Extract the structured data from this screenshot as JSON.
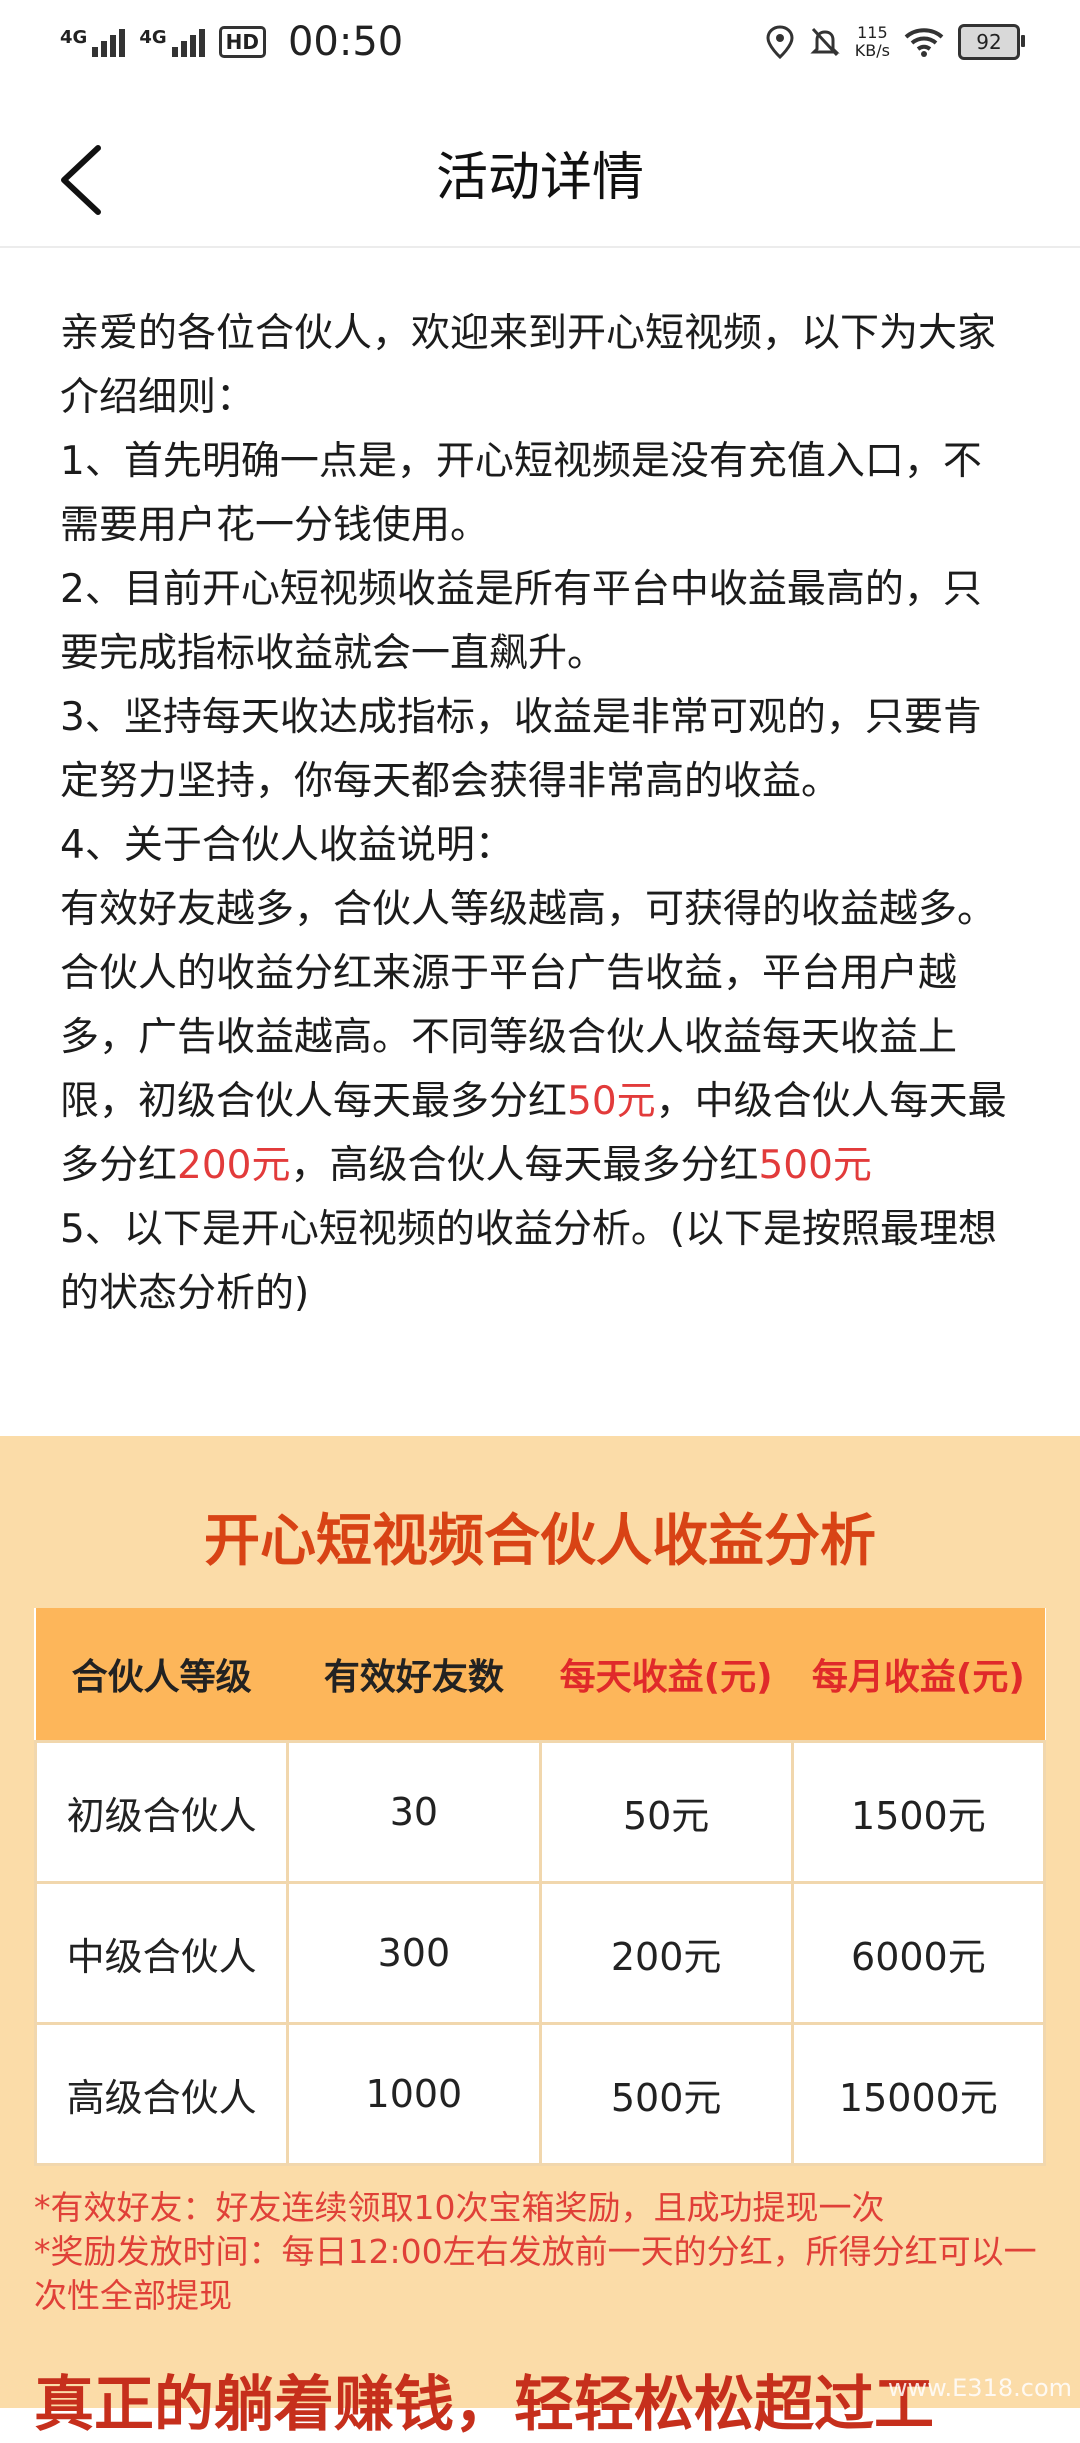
{
  "status_bar": {
    "signal1_label": "4G",
    "signal2_label": "4G",
    "hd_label": "HD",
    "time": "00:50",
    "speed_value": "115",
    "speed_unit": "KB/s",
    "battery": "92"
  },
  "header": {
    "title": "活动详情"
  },
  "intro": {
    "lines": [
      "亲爱的各位合伙人，欢迎来到开心短视频，以下为大家介绍细则：",
      "1、首先明确一点是，开心短视频是没有充值入口，不需要用户花一分钱使用。",
      "2、目前开心短视频收益是所有平台中收益最高的，只要完成指标收益就会一直飙升。",
      "3、坚持每天收达成指标，收益是非常可观的，只要肯定努力坚持，你每天都会获得非常高的收益。",
      "4、关于合伙人收益说明："
    ],
    "p6_a": "有效好友越多，合伙人等级越高，可获得的收益越多。合伙人的收益分红来源于平台广告收益，平台用户越多，广告收益越高。不同等级合伙人收益每天收益上限，初级合伙人每天最多分红",
    "p6_r1": "50元",
    "p6_b": "，中级合伙人每天最多分红",
    "p6_r2": "200元",
    "p6_c": "，高级合伙人每天最多分红",
    "p6_r3": "500元",
    "p7": "5、以下是开心短视频的收益分析。(以下是按照最理想的状态分析的)"
  },
  "promo": {
    "title": "开心短视频合伙人收益分析",
    "table": {
      "headers": [
        "合伙人等级",
        "有效好友数",
        "每天收益(元)",
        "每月收益(元)"
      ],
      "rows": [
        [
          "初级合伙人",
          "30",
          "50元",
          "1500元"
        ],
        [
          "中级合伙人",
          "300",
          "200元",
          "6000元"
        ],
        [
          "高级合伙人",
          "1000",
          "500元",
          "15000元"
        ]
      ]
    },
    "notes": [
      "*有效好友：好友连续领取10次宝箱奖励，且成功提现一次",
      "*奖励发放时间：每日12:00左右发放前一天的分红，所得分红可以一次性全部提现"
    ],
    "bottom_heading": "真正的躺着赚钱，轻轻松松超过工",
    "watermark": "www.E318.com"
  },
  "colors": {
    "accent_red": "#e23b3b",
    "promo_bg": "#fbdca8",
    "table_header_bg": "#fdb65a",
    "title_orange": "#d84315"
  }
}
